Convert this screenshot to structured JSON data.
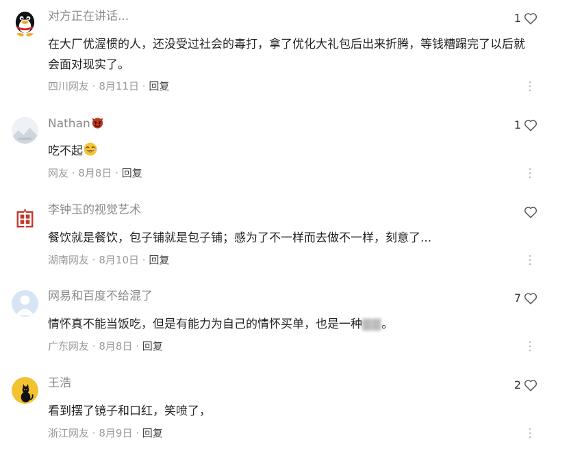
{
  "comments": [
    {
      "username": "对方正在讲话...",
      "content": "在大厂优渥惯的人，还没受过社会的毒打，拿了优化大礼包后出来折腾，等钱糟蹋完了以后就会面对现实了。",
      "location": "四川网友",
      "date": "8月11日",
      "reply_label": "回复",
      "like_count": "1",
      "avatar_icon": "penguin-avatar"
    },
    {
      "username": "Nathan",
      "badge_icon": "devil-emoji",
      "content": "吃不起",
      "content_emoji_icon": "laughing-emoji",
      "location": "网友",
      "date": "8月8日",
      "reply_label": "回复",
      "like_count": "1",
      "avatar_icon": "landscape-avatar"
    },
    {
      "username": "李钟玉的视觉艺术",
      "content": "餐饮就是餐饮，包子铺就是包子铺；感为了不一样而去做不一样，刻意了...",
      "location": "湖南网友",
      "date": "8月10日",
      "reply_label": "回复",
      "like_count": "",
      "avatar_icon": "red-seal-avatar"
    },
    {
      "username": "网易和百度不给混了",
      "content": "情怀真不能当饭吃，但是有能力为自己的情怀买单，也是一种",
      "content_tail": "。",
      "location": "广东网友",
      "date": "8月8日",
      "reply_label": "回复",
      "like_count": "7",
      "avatar_icon": "default-user-avatar"
    },
    {
      "username": "王浩",
      "content": "看到摆了镜子和口红，笑喷了，",
      "location": "浙江网友",
      "date": "8月9日",
      "reply_label": "回复",
      "like_count": "2",
      "avatar_icon": "black-cat-avatar"
    }
  ],
  "meta_separator": "·",
  "colors": {
    "username": "#8a8a8a",
    "content": "#222222",
    "meta": "#9a9a9a",
    "reply": "#444444",
    "heart_outline": "#555555"
  }
}
